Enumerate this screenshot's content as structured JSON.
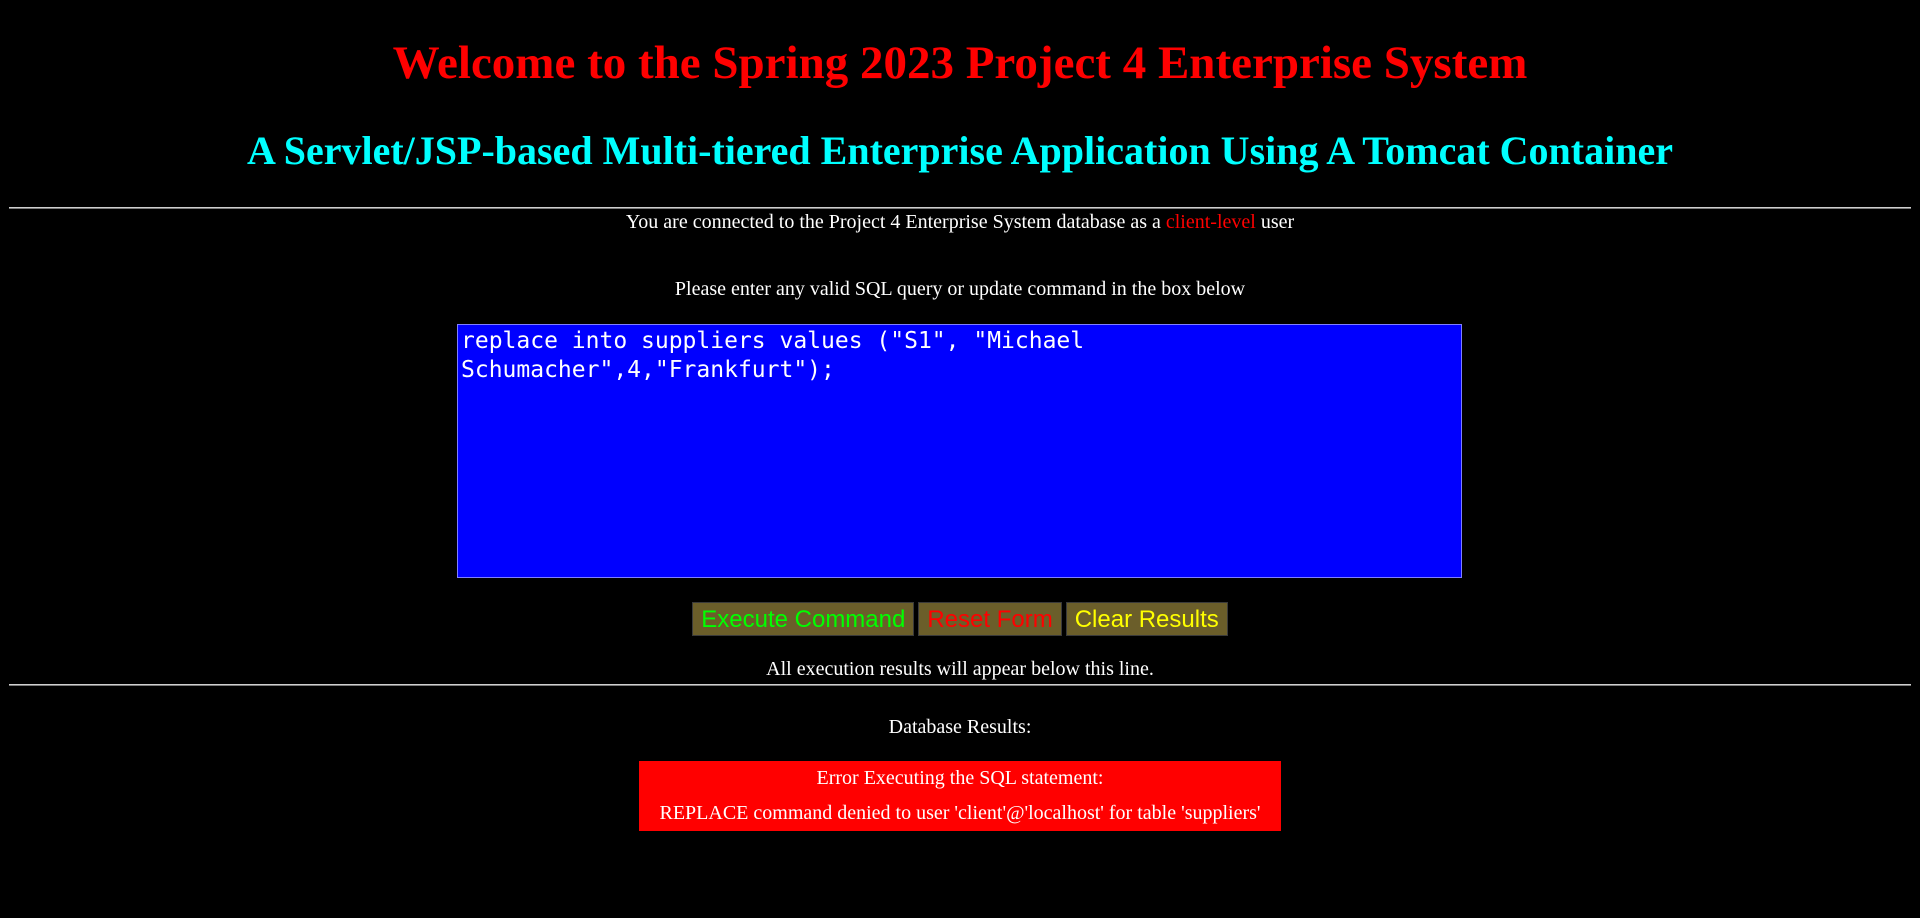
{
  "header": {
    "title": "Welcome to the Spring 2023 Project 4 Enterprise System",
    "subtitle": "A Servlet/JSP-based Multi-tiered Enterprise Application Using A Tomcat Container"
  },
  "connection": {
    "prefix": "You are connected to the Project 4 Enterprise System database as a",
    "user_level": "client-level",
    "suffix": "user"
  },
  "instructions": "Please enter any valid SQL query or update command in the box below",
  "sql_input": {
    "value": "replace into suppliers values (\"S1\", \"Michael Schumacher\",4,\"Frankfurt\");"
  },
  "buttons": {
    "execute_label": "Execute Command",
    "reset_label": "Reset Form",
    "clear_label": "Clear Results"
  },
  "results_note": "All execution results will appear below this line.",
  "results": {
    "label": "Database Results:",
    "error_title": "Error Executing the SQL statement:",
    "error_message": "REPLACE command denied to user 'client'@'localhost' for table 'suppliers'"
  },
  "colors": {
    "background": "#000000",
    "title": "#ff0000",
    "subtitle": "#00ffff",
    "textarea_bg": "#0000ff",
    "button_bg": "#6b5e2a",
    "execute_text": "#00ff00",
    "reset_text": "#ff0000",
    "clear_text": "#ffff00",
    "error_bg": "#ff0000"
  }
}
